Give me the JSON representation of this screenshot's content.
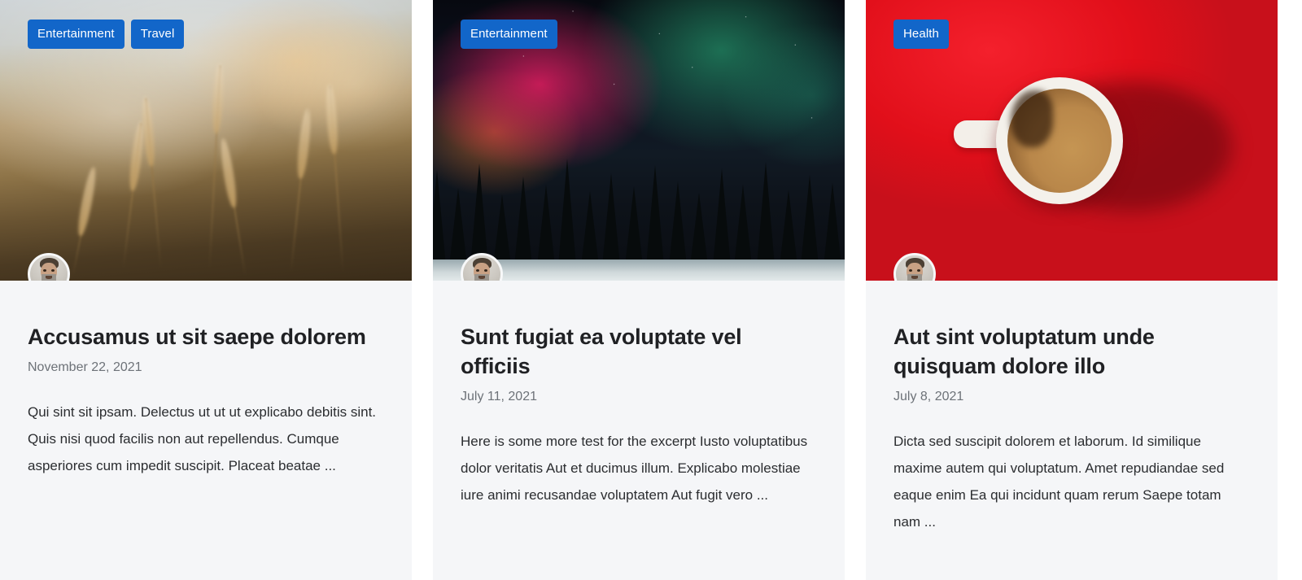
{
  "layout": {
    "card_count": 3,
    "colors": {
      "page_background": "#ffffff",
      "card_background": "#f5f6f8",
      "tag_background": "#1266c9",
      "tag_text": "#ffffff",
      "title_text": "#202124",
      "date_text": "#6d7278",
      "excerpt_text": "#2b2d30"
    }
  },
  "cards": [
    {
      "tags": [
        "Entertainment",
        "Travel"
      ],
      "image_alt": "blurred-wheat-field-photo",
      "avatar_alt": "author-avatar-photo",
      "title": "Accusamus ut sit saepe dolorem",
      "date": "November 22, 2021",
      "excerpt": "Qui sint sit ipsam. Delectus ut ut ut explicabo debitis sint. Quis nisi quod facilis non aut repellendus. Cumque asperiores cum impedit suscipit. Placeat beatae ..."
    },
    {
      "tags": [
        "Entertainment"
      ],
      "image_alt": "aurora-over-pine-forest-photo",
      "avatar_alt": "author-avatar-photo",
      "title": "Sunt fugiat ea voluptate vel officiis",
      "date": "July 11, 2021",
      "excerpt": "Here is some more test for the excerpt Iusto voluptatibus dolor veritatis Aut et ducimus illum. Explicabo molestiae iure animi recusandae voluptatem Aut fugit vero ..."
    },
    {
      "tags": [
        "Health"
      ],
      "image_alt": "coffee-cup-on-red-background-photo",
      "avatar_alt": "author-avatar-photo",
      "title": "Aut sint voluptatum unde quisquam dolore illo",
      "date": "July 8, 2021",
      "excerpt": "Dicta sed suscipit dolorem et laborum. Id similique maxime autem qui voluptatum. Amet repudiandae sed eaque enim Ea qui incidunt quam rerum Saepe totam nam ..."
    }
  ]
}
